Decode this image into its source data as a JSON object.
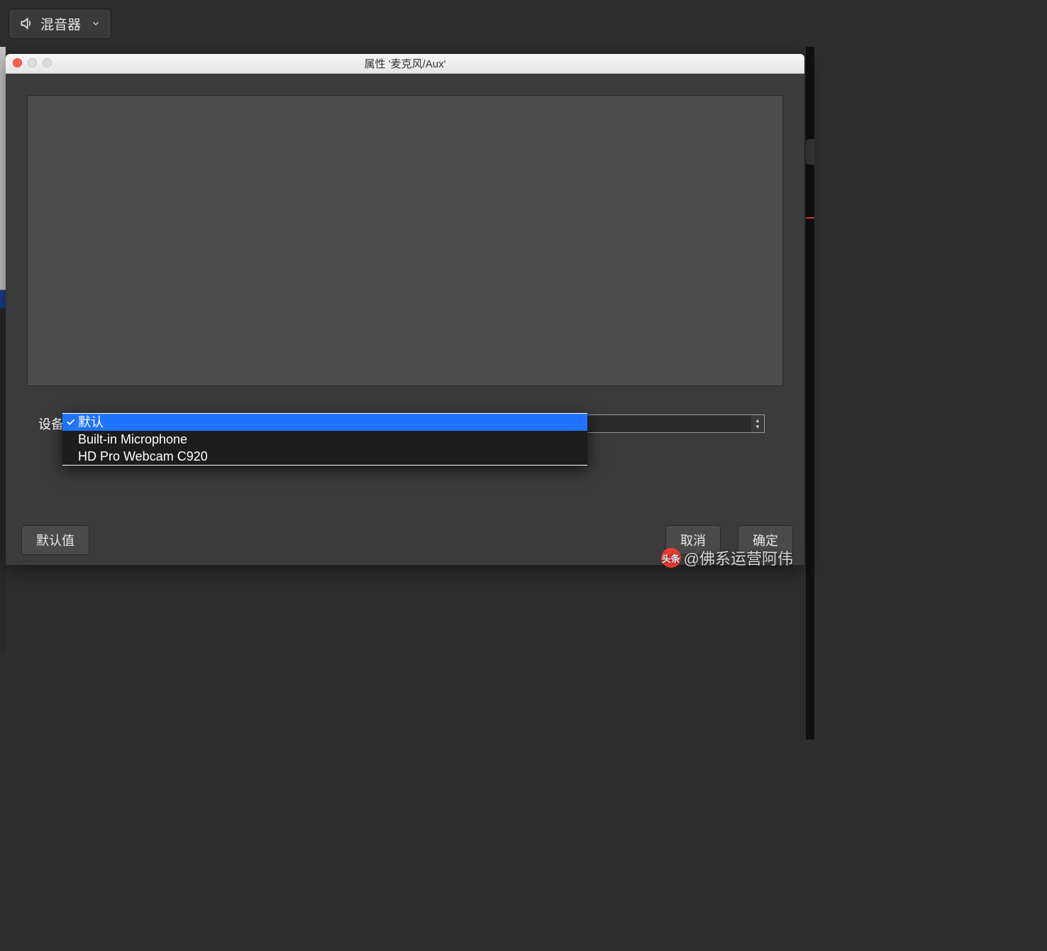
{
  "toolbar": {
    "mixer_label": "混音器"
  },
  "dialog": {
    "title": "属性 '麦克风/Aux'",
    "device_label": "设备",
    "dropdown": {
      "selected_index": 0,
      "options": [
        {
          "label": "默认",
          "selected": true
        },
        {
          "label": "Built-in Microphone",
          "selected": false
        },
        {
          "label": "HD Pro Webcam C920",
          "selected": false
        }
      ]
    },
    "buttons": {
      "defaults": "默认值",
      "cancel": "取消",
      "ok": "确定"
    }
  },
  "watermark": {
    "logo_text": "头条",
    "text": "@佛系运营阿伟"
  },
  "colors": {
    "selection": "#1f74ff",
    "close_red": "#ff5f57",
    "accent_red": "#ff3b30"
  }
}
